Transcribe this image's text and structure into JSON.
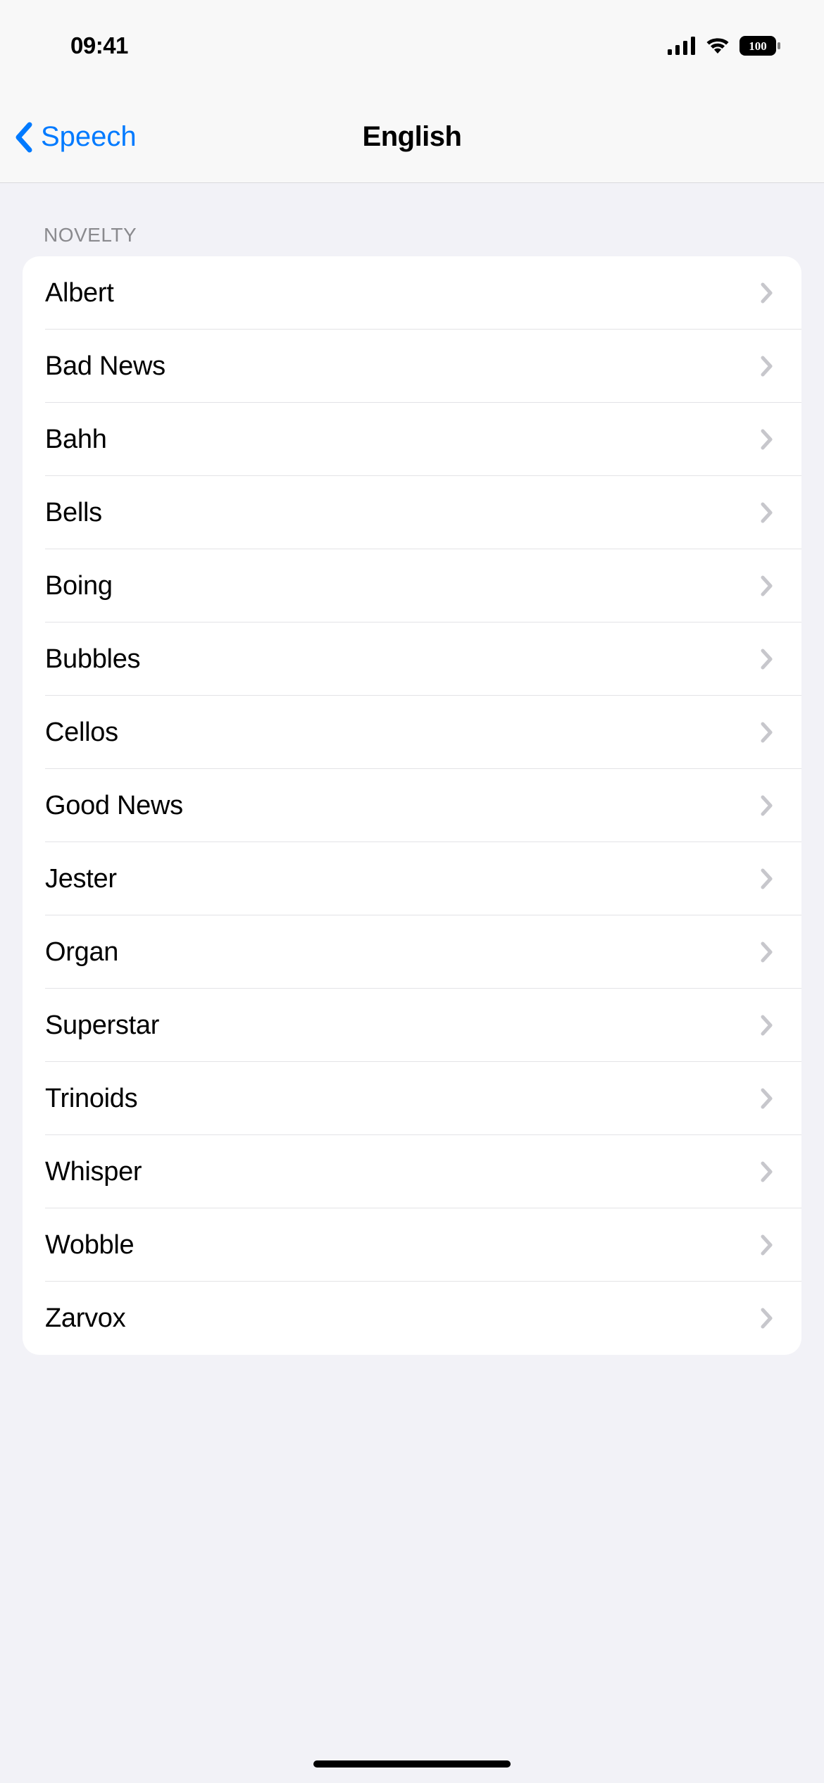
{
  "status": {
    "time": "09:41",
    "battery": "100"
  },
  "nav": {
    "back_label": "Speech",
    "title": "English"
  },
  "section": {
    "header": "NOVELTY"
  },
  "voices": [
    {
      "label": "Albert"
    },
    {
      "label": "Bad News"
    },
    {
      "label": "Bahh"
    },
    {
      "label": "Bells"
    },
    {
      "label": "Boing"
    },
    {
      "label": "Bubbles"
    },
    {
      "label": "Cellos"
    },
    {
      "label": "Good News"
    },
    {
      "label": "Jester"
    },
    {
      "label": "Organ"
    },
    {
      "label": "Superstar"
    },
    {
      "label": "Trinoids"
    },
    {
      "label": "Whisper"
    },
    {
      "label": "Wobble"
    },
    {
      "label": "Zarvox"
    }
  ]
}
